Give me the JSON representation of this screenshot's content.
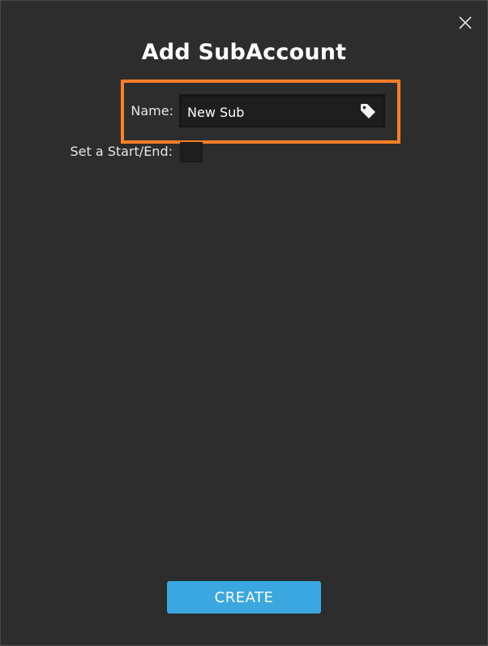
{
  "dialog": {
    "title": "Add SubAccount",
    "close_icon": "close-icon"
  },
  "form": {
    "name_label": "Name:",
    "name_value": "New Sub",
    "name_icon": "tag-icon",
    "startend_label": "Set a Start/End:",
    "startend_checked": false
  },
  "actions": {
    "create_label": "CREATE"
  },
  "colors": {
    "background": "#2d2d2d",
    "input_background": "#1e1e1e",
    "highlight": "#ff7f27",
    "primary_button": "#3aa7e0"
  }
}
